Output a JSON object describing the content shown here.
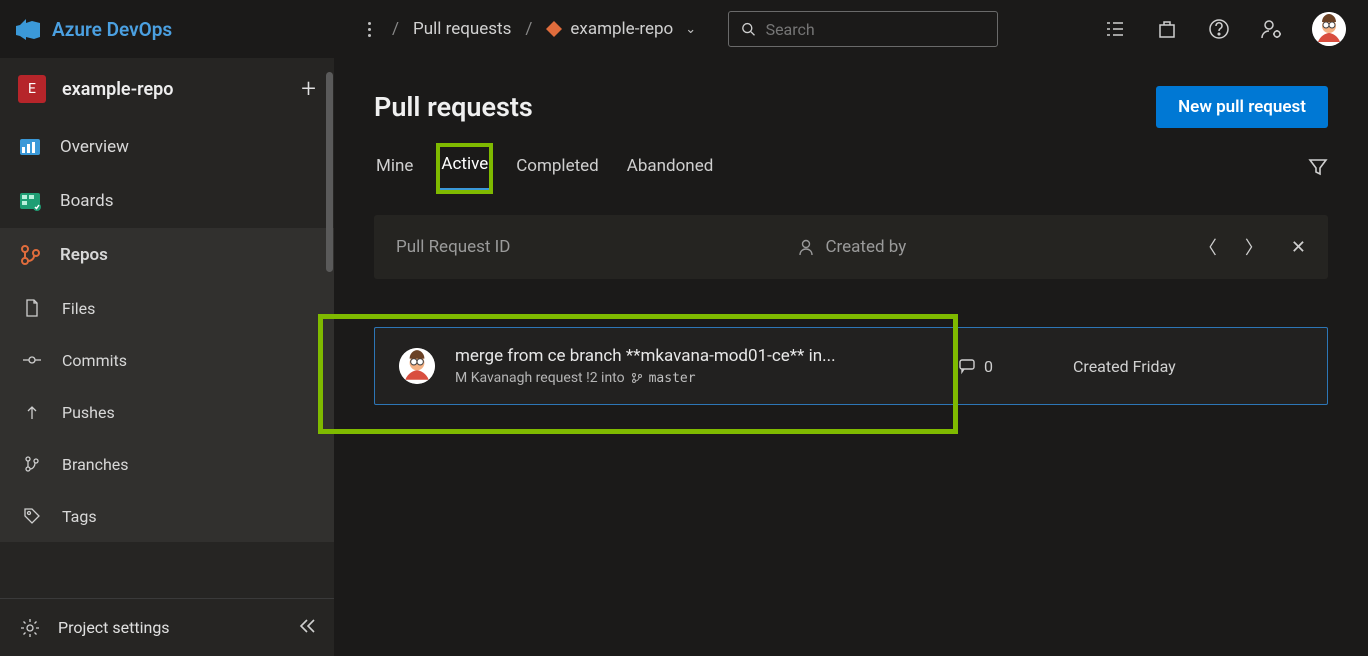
{
  "brand": "Azure DevOps",
  "breadcrumb": {
    "page": "Pull requests",
    "repo": "example-repo"
  },
  "search": {
    "placeholder": "Search"
  },
  "project": {
    "initial": "E",
    "name": "example-repo"
  },
  "sidebar": {
    "overview": "Overview",
    "boards": "Boards",
    "repos": "Repos",
    "files": "Files",
    "commits": "Commits",
    "pushes": "Pushes",
    "branches": "Branches",
    "tags": "Tags",
    "settings": "Project settings"
  },
  "page": {
    "title": "Pull requests",
    "new_pr": "New pull request",
    "tabs": {
      "mine": "Mine",
      "active": "Active",
      "completed": "Completed",
      "abandoned": "Abandoned"
    }
  },
  "filters": {
    "pr_id": "Pull Request ID",
    "created_by": "Created by"
  },
  "pr": {
    "title": "merge from ce branch **mkavana-mod01-ce** in...",
    "author": "M Kavanagh request !2 into",
    "target": "master",
    "comments": "0",
    "created": "Created Friday"
  }
}
